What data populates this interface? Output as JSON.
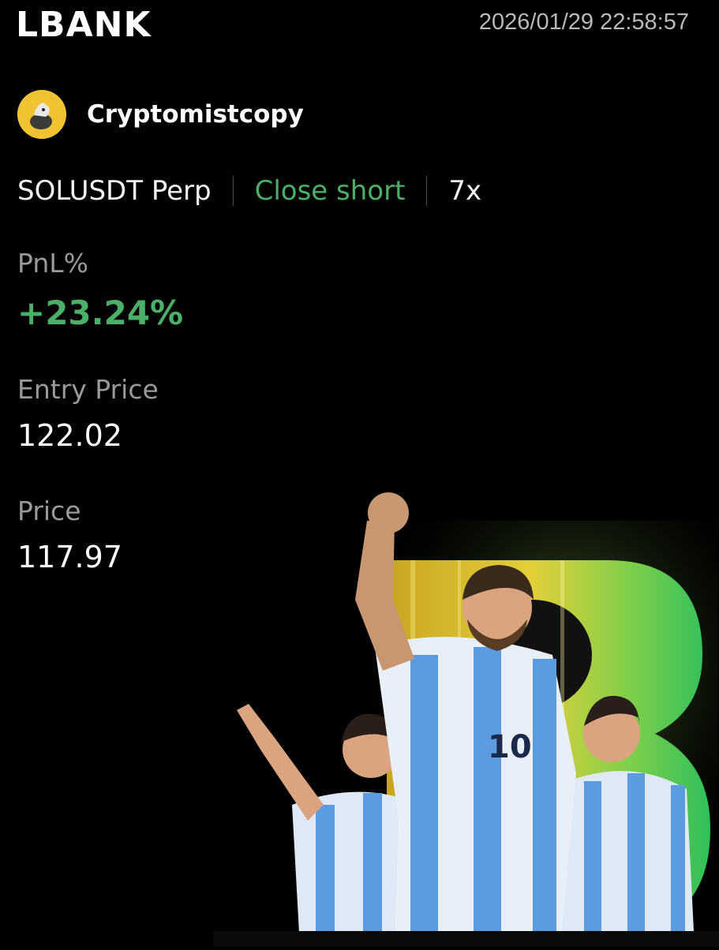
{
  "header": {
    "logo": "LBANK",
    "timestamp": "2026/01/29 22:58:57"
  },
  "user": {
    "name": "Cryptomistcopy"
  },
  "trade": {
    "symbol": "SOLUSDT Perp",
    "action": "Close short",
    "leverage": "7x"
  },
  "stats": {
    "pnl_label": "PnL%",
    "pnl_value": "+23.24%",
    "entry_label": "Entry Price",
    "entry_value": "122.02",
    "price_label": "Price",
    "price_value": "117.97"
  },
  "colors": {
    "background": "#000000",
    "positive": "#4caf68",
    "muted": "#9a9a9a",
    "avatar": "#f1c232"
  },
  "banner": {
    "jersey_number": "10"
  }
}
